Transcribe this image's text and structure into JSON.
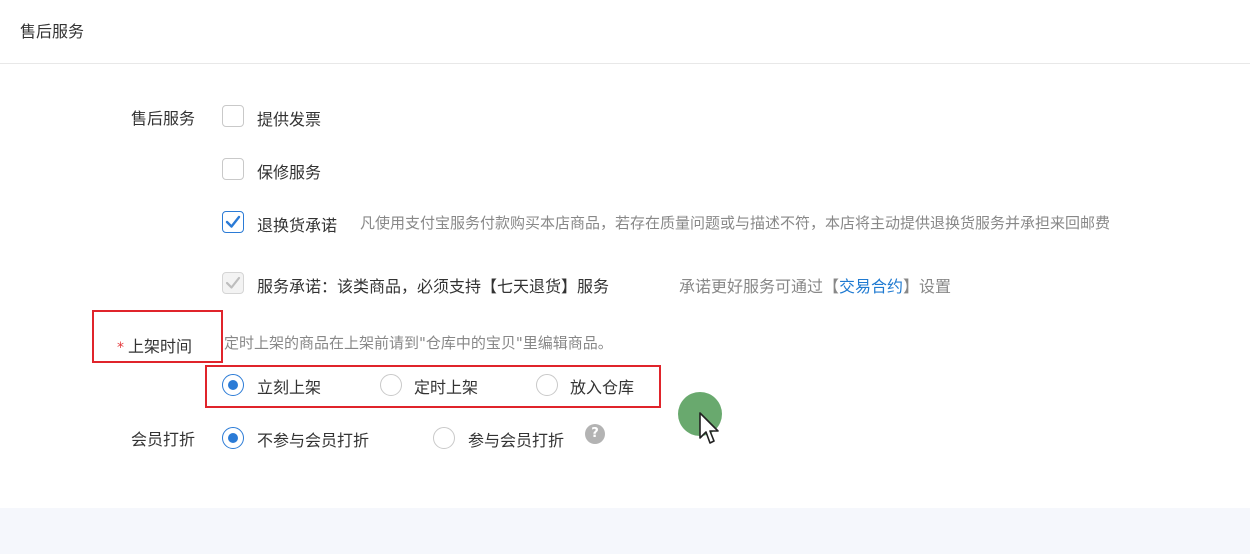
{
  "header": {
    "title": "售后服务"
  },
  "after_sales": {
    "label": "售后服务",
    "invoice": "提供发票",
    "warranty": "保修服务",
    "return_promise": "退换货承诺",
    "return_promise_desc": "凡使用支付宝服务付款购买本店商品，若存在质量问题或与描述不符，本店将主动提供退换货服务并承担来回邮费",
    "service_promise": "服务承诺：该类商品，必须支持【七天退货】服务",
    "service_promise_hint": "承诺更好服务可通过【",
    "contract_link": "交易合约",
    "service_promise_suffix": "】设置"
  },
  "listing_time": {
    "label": "上架时间",
    "required_mark": "*",
    "hint": "定时上架的商品在上架前请到\"仓库中的宝贝\"里编辑商品。",
    "options": [
      "立刻上架",
      "定时上架",
      "放入仓库"
    ],
    "selected": "立刻上架"
  },
  "member_discount": {
    "label": "会员打折",
    "options": [
      "不参与会员打折",
      "参与会员打折"
    ],
    "selected": "不参与会员打折",
    "help_icon": "?"
  },
  "colors": {
    "accent": "#2b7bd6",
    "highlight": "#e0242b",
    "link": "#1f7ad1"
  },
  "icons": {
    "check": "check-icon",
    "help": "question-icon",
    "cursor": "mouse-pointer-icon"
  }
}
